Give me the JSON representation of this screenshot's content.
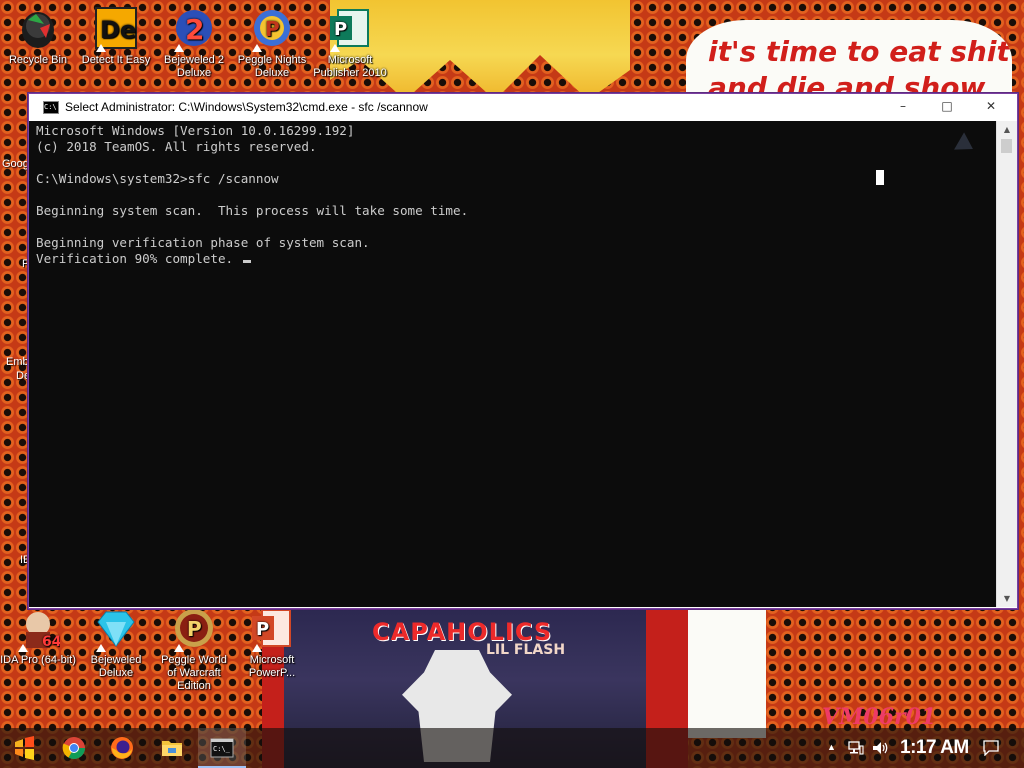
{
  "wallpaper": {
    "speech_text_line1": "it's time to eat shit",
    "speech_text_line2": "and die and show",
    "album_title": "CAPAHOLICS",
    "album_sub": "LIL FLASH",
    "watermark": "VM06r01"
  },
  "desktop_icons": [
    {
      "label": "Recycle Bin",
      "icon": "recycle-bin-icon"
    },
    {
      "label": "Detect It Easy",
      "icon": "die-icon"
    },
    {
      "label": "Bejeweled 2 Deluxe",
      "icon": "bejeweled2-icon"
    },
    {
      "label": "Peggle Nights Deluxe",
      "icon": "peggle-nights-icon"
    },
    {
      "label": "Microsoft Publisher 2010",
      "icon": "publisher-icon"
    },
    {
      "label": "IDA Pro (64-bit)",
      "icon": "ida-pro-icon"
    },
    {
      "label": "Bejeweled Deluxe",
      "icon": "bejeweled-icon"
    },
    {
      "label": "Peggle World of Warcraft Edition",
      "icon": "peggle-wow-icon"
    },
    {
      "label": "Microsoft PowerP...",
      "icon": "powerpoint-icon"
    }
  ],
  "left_edge_labels": [
    "Goog",
    "F",
    "Emb",
    "De",
    "IE"
  ],
  "cmd": {
    "title": "Select Administrator: C:\\Windows\\System32\\cmd.exe - sfc  /scannow",
    "icon_text": "C:\\",
    "minimize": "–",
    "maximize": "□",
    "close": "✕",
    "lines": [
      "Microsoft Windows [Version 10.0.16299.192]",
      "(c) 2018 TeamOS. All rights reserved.",
      "",
      "C:\\Windows\\system32>sfc /scannow",
      "",
      "Beginning system scan.  This process will take some time.",
      "",
      "Beginning verification phase of system scan.",
      "Verification 90% complete."
    ],
    "verification_progress_percent": 90
  },
  "taskbar": {
    "items": [
      {
        "name": "start-button",
        "icon": "start-icon"
      },
      {
        "name": "chrome-taskbar-button",
        "icon": "chrome-icon"
      },
      {
        "name": "firefox-taskbar-button",
        "icon": "firefox-icon"
      },
      {
        "name": "explorer-taskbar-button",
        "icon": "folder-icon"
      },
      {
        "name": "cmd-taskbar-button",
        "icon": "cmd-icon",
        "active": true
      }
    ],
    "tray": {
      "chevron": "▲",
      "clock": "1:17 AM",
      "notification_icon": "action-center-icon"
    }
  }
}
